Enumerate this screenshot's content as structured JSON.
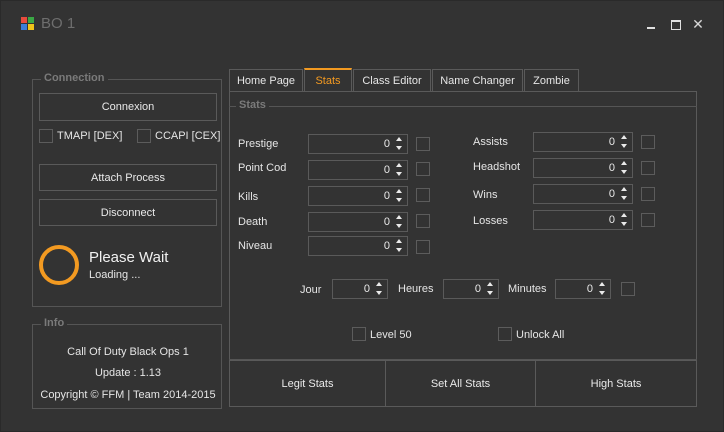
{
  "window": {
    "title": "BO 1",
    "icon_colors": [
      "#e84c3d",
      "#3aa845",
      "#3b7dd8",
      "#f0c419"
    ]
  },
  "connection": {
    "legend": "Connection",
    "connexion_label": "Connexion",
    "tmapi_label": "TMAPI [DEX]",
    "ccapi_label": "CCAPI [CEX]",
    "attach_label": "Attach Process",
    "disconnect_label": "Disconnect",
    "status_title": "Please Wait",
    "status_sub": "Loading ..."
  },
  "info": {
    "legend": "Info",
    "game": "Call Of Duty Black Ops 1",
    "update": "Update : 1.13",
    "copyright": "Copyright © FFM | Team 2014-2015"
  },
  "tabs": [
    {
      "label": "Home Page"
    },
    {
      "label": "Stats"
    },
    {
      "label": "Class Editor"
    },
    {
      "label": "Name Changer"
    },
    {
      "label": "Zombie"
    }
  ],
  "stats": {
    "legend": "Stats",
    "left_fields": [
      {
        "label": "Prestige",
        "value": "0"
      },
      {
        "label": "Point Cod",
        "value": "0"
      },
      {
        "label": "Kills",
        "value": "0"
      },
      {
        "label": "Death",
        "value": "0"
      },
      {
        "label": "Niveau",
        "value": "0"
      }
    ],
    "right_fields": [
      {
        "label": "Assists",
        "value": "0"
      },
      {
        "label": "Headshot",
        "value": "0"
      },
      {
        "label": "Wins",
        "value": "0"
      },
      {
        "label": "Losses",
        "value": "0"
      }
    ],
    "time_fields": [
      {
        "label": "Jour",
        "value": "0"
      },
      {
        "label": "Heures",
        "value": "0"
      },
      {
        "label": "Minutes",
        "value": "0"
      }
    ],
    "level50_label": "Level 50",
    "unlock_all_label": "Unlock All"
  },
  "actions": {
    "legit_label": "Legit Stats",
    "set_all_label": "Set All Stats",
    "high_label": "High Stats"
  },
  "accent_color": "#f39a21"
}
